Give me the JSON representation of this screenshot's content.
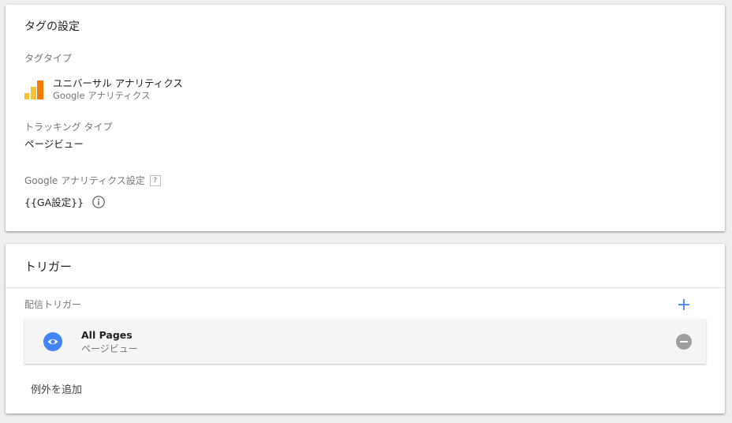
{
  "tag_config": {
    "title": "タグの設定",
    "tag_type_label": "タグタイプ",
    "tag_type_name": "ユニバーサル アナリティクス",
    "tag_type_sub": "Google アナリティクス",
    "tracking_type_label": "トラッキング タイプ",
    "tracking_type_value": "ページビュー",
    "ga_settings_label": "Google アナリティクス設定",
    "ga_settings_help": "?",
    "ga_settings_value": "{{GA設定}}"
  },
  "triggers": {
    "title": "トリガー",
    "firing_label": "配信トリガー",
    "items": [
      {
        "name": "All Pages",
        "type": "ページビュー"
      }
    ],
    "add_exception_label": "例外を追加"
  },
  "colors": {
    "accent_blue": "#4285f4",
    "ga_orange": "#f57c00",
    "ga_yellow": "#fbc02d",
    "remove_gray": "#9e9e9e"
  },
  "icons": [
    "ga-logo-icon",
    "help-icon",
    "info-icon",
    "add-icon",
    "eye-icon",
    "remove-icon"
  ]
}
